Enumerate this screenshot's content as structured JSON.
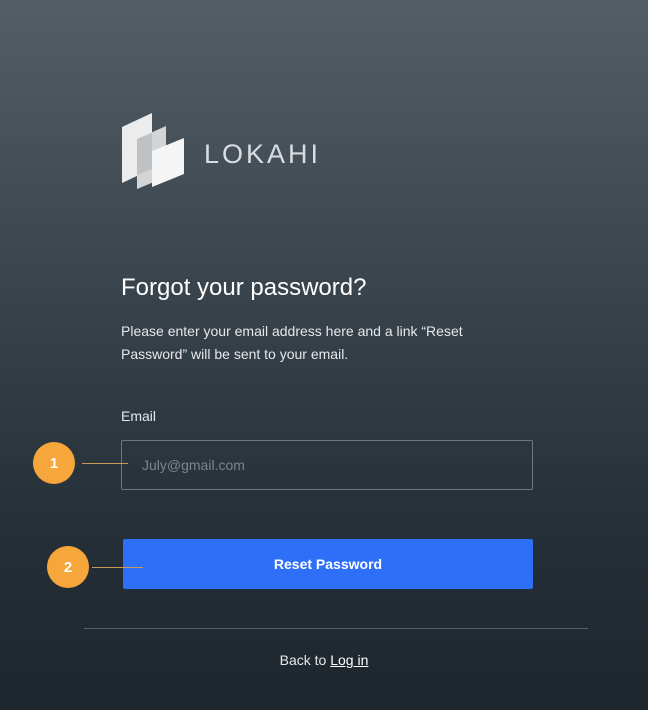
{
  "brand": {
    "name": "LOKAHI"
  },
  "page": {
    "title": "Forgot your password?",
    "description": "Please enter your email address here and a link “Reset Password” will be sent to your email."
  },
  "form": {
    "email_label": "Email",
    "email_placeholder": "July@gmail.com",
    "email_value": "",
    "submit_label": "Reset Password"
  },
  "footer": {
    "back_prefix": "Back to ",
    "login_link": "Log in"
  },
  "callouts": [
    {
      "number": "1",
      "target": "email-input"
    },
    {
      "number": "2",
      "target": "reset-button"
    }
  ],
  "colors": {
    "accent": "#2d6ff7",
    "callout": "#f6a63a",
    "background_top": "#535e67",
    "background_bottom": "#1e262d"
  }
}
